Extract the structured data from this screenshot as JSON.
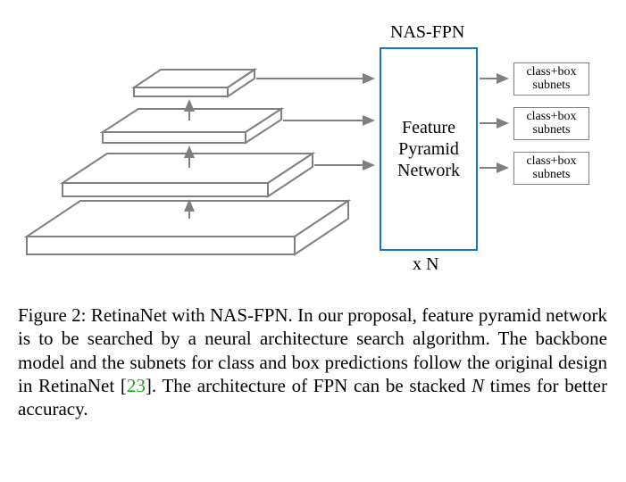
{
  "diagram": {
    "title": "NAS-FPN",
    "fpn_box_line1": "Feature",
    "fpn_box_line2": "Pyramid",
    "fpn_box_line3": "Network",
    "repeat_label": "x N",
    "subnet_line1": "class+box",
    "subnet_line2": "subnets"
  },
  "caption": {
    "prefix": "Figure 2: RetinaNet with NAS-FPN. In our proposal, feature pyramid network is to be searched by a neural architecture search algorithm. The backbone model and the subnets for class and box predictions follow the original design in RetinaNet [",
    "cite": "23",
    "mid": "]. The architecture of FPN can be stacked ",
    "nvar": "N",
    "suffix": " times for better accuracy."
  }
}
